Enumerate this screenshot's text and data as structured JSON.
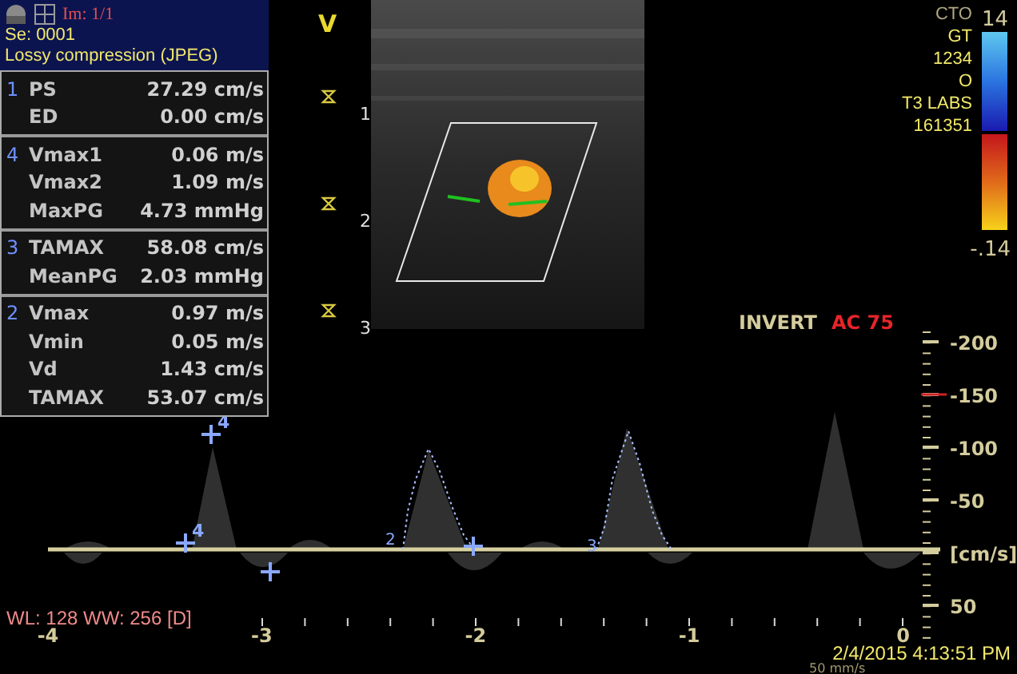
{
  "header": {
    "image_index": "Im: 1/1",
    "series": "Se: 0001",
    "compression_note": "Lossy compression (JPEG)"
  },
  "measurement_groups": [
    {
      "index": "1",
      "rows": [
        {
          "label": "PS",
          "value": "27.29 cm/s"
        },
        {
          "label": "ED",
          "value": "0.00 cm/s"
        }
      ]
    },
    {
      "index": "4",
      "rows": [
        {
          "label": "Vmax1",
          "value": "0.06 m/s"
        },
        {
          "label": "Vmax2",
          "value": "1.09 m/s"
        },
        {
          "label": "MaxPG",
          "value": "4.73 mmHg"
        }
      ]
    },
    {
      "index": "3",
      "rows": [
        {
          "label": "TAMAX",
          "value": "58.08 cm/s"
        },
        {
          "label": "MeanPG",
          "value": "2.03 mmHg"
        }
      ]
    },
    {
      "index": "2",
      "rows": [
        {
          "label": "Vmax",
          "value": "0.97 m/s"
        },
        {
          "label": "Vmin",
          "value": "0.05 m/s"
        },
        {
          "label": "Vd",
          "value": "1.43 cm/s"
        },
        {
          "label": "TAMAX",
          "value": "53.07 cm/s"
        }
      ]
    }
  ],
  "depth_scale": {
    "marker": "V",
    "ticks": [
      "1",
      "2",
      "3"
    ]
  },
  "patient_info": [
    "CTO",
    "GT",
    "1234",
    "O",
    "T3 LABS",
    "161351"
  ],
  "color_bar": {
    "max_label": "14",
    "min_label": "-.14"
  },
  "mode_labels": [
    {
      "text": "INVERT",
      "kind": "normal"
    },
    {
      "text": "AC 75",
      "kind": "alert"
    }
  ],
  "velocity_scale": [
    "-200",
    "-150",
    "-100",
    "-50",
    "[cm/s]",
    "50"
  ],
  "time_axis": [
    "-4",
    "-3",
    "-2",
    "-1",
    "0"
  ],
  "calipers": [
    {
      "label": "4",
      "kind": "cross"
    },
    {
      "label": "4",
      "kind": "cross"
    },
    {
      "label": "2",
      "kind": "trace"
    },
    {
      "label": "3",
      "kind": "trace"
    }
  ],
  "window_level": "WL: 128 WW: 256 [D]",
  "date_time": "2/4/2015 4:13:51 PM",
  "sweep_speed": "50 mm/s"
}
